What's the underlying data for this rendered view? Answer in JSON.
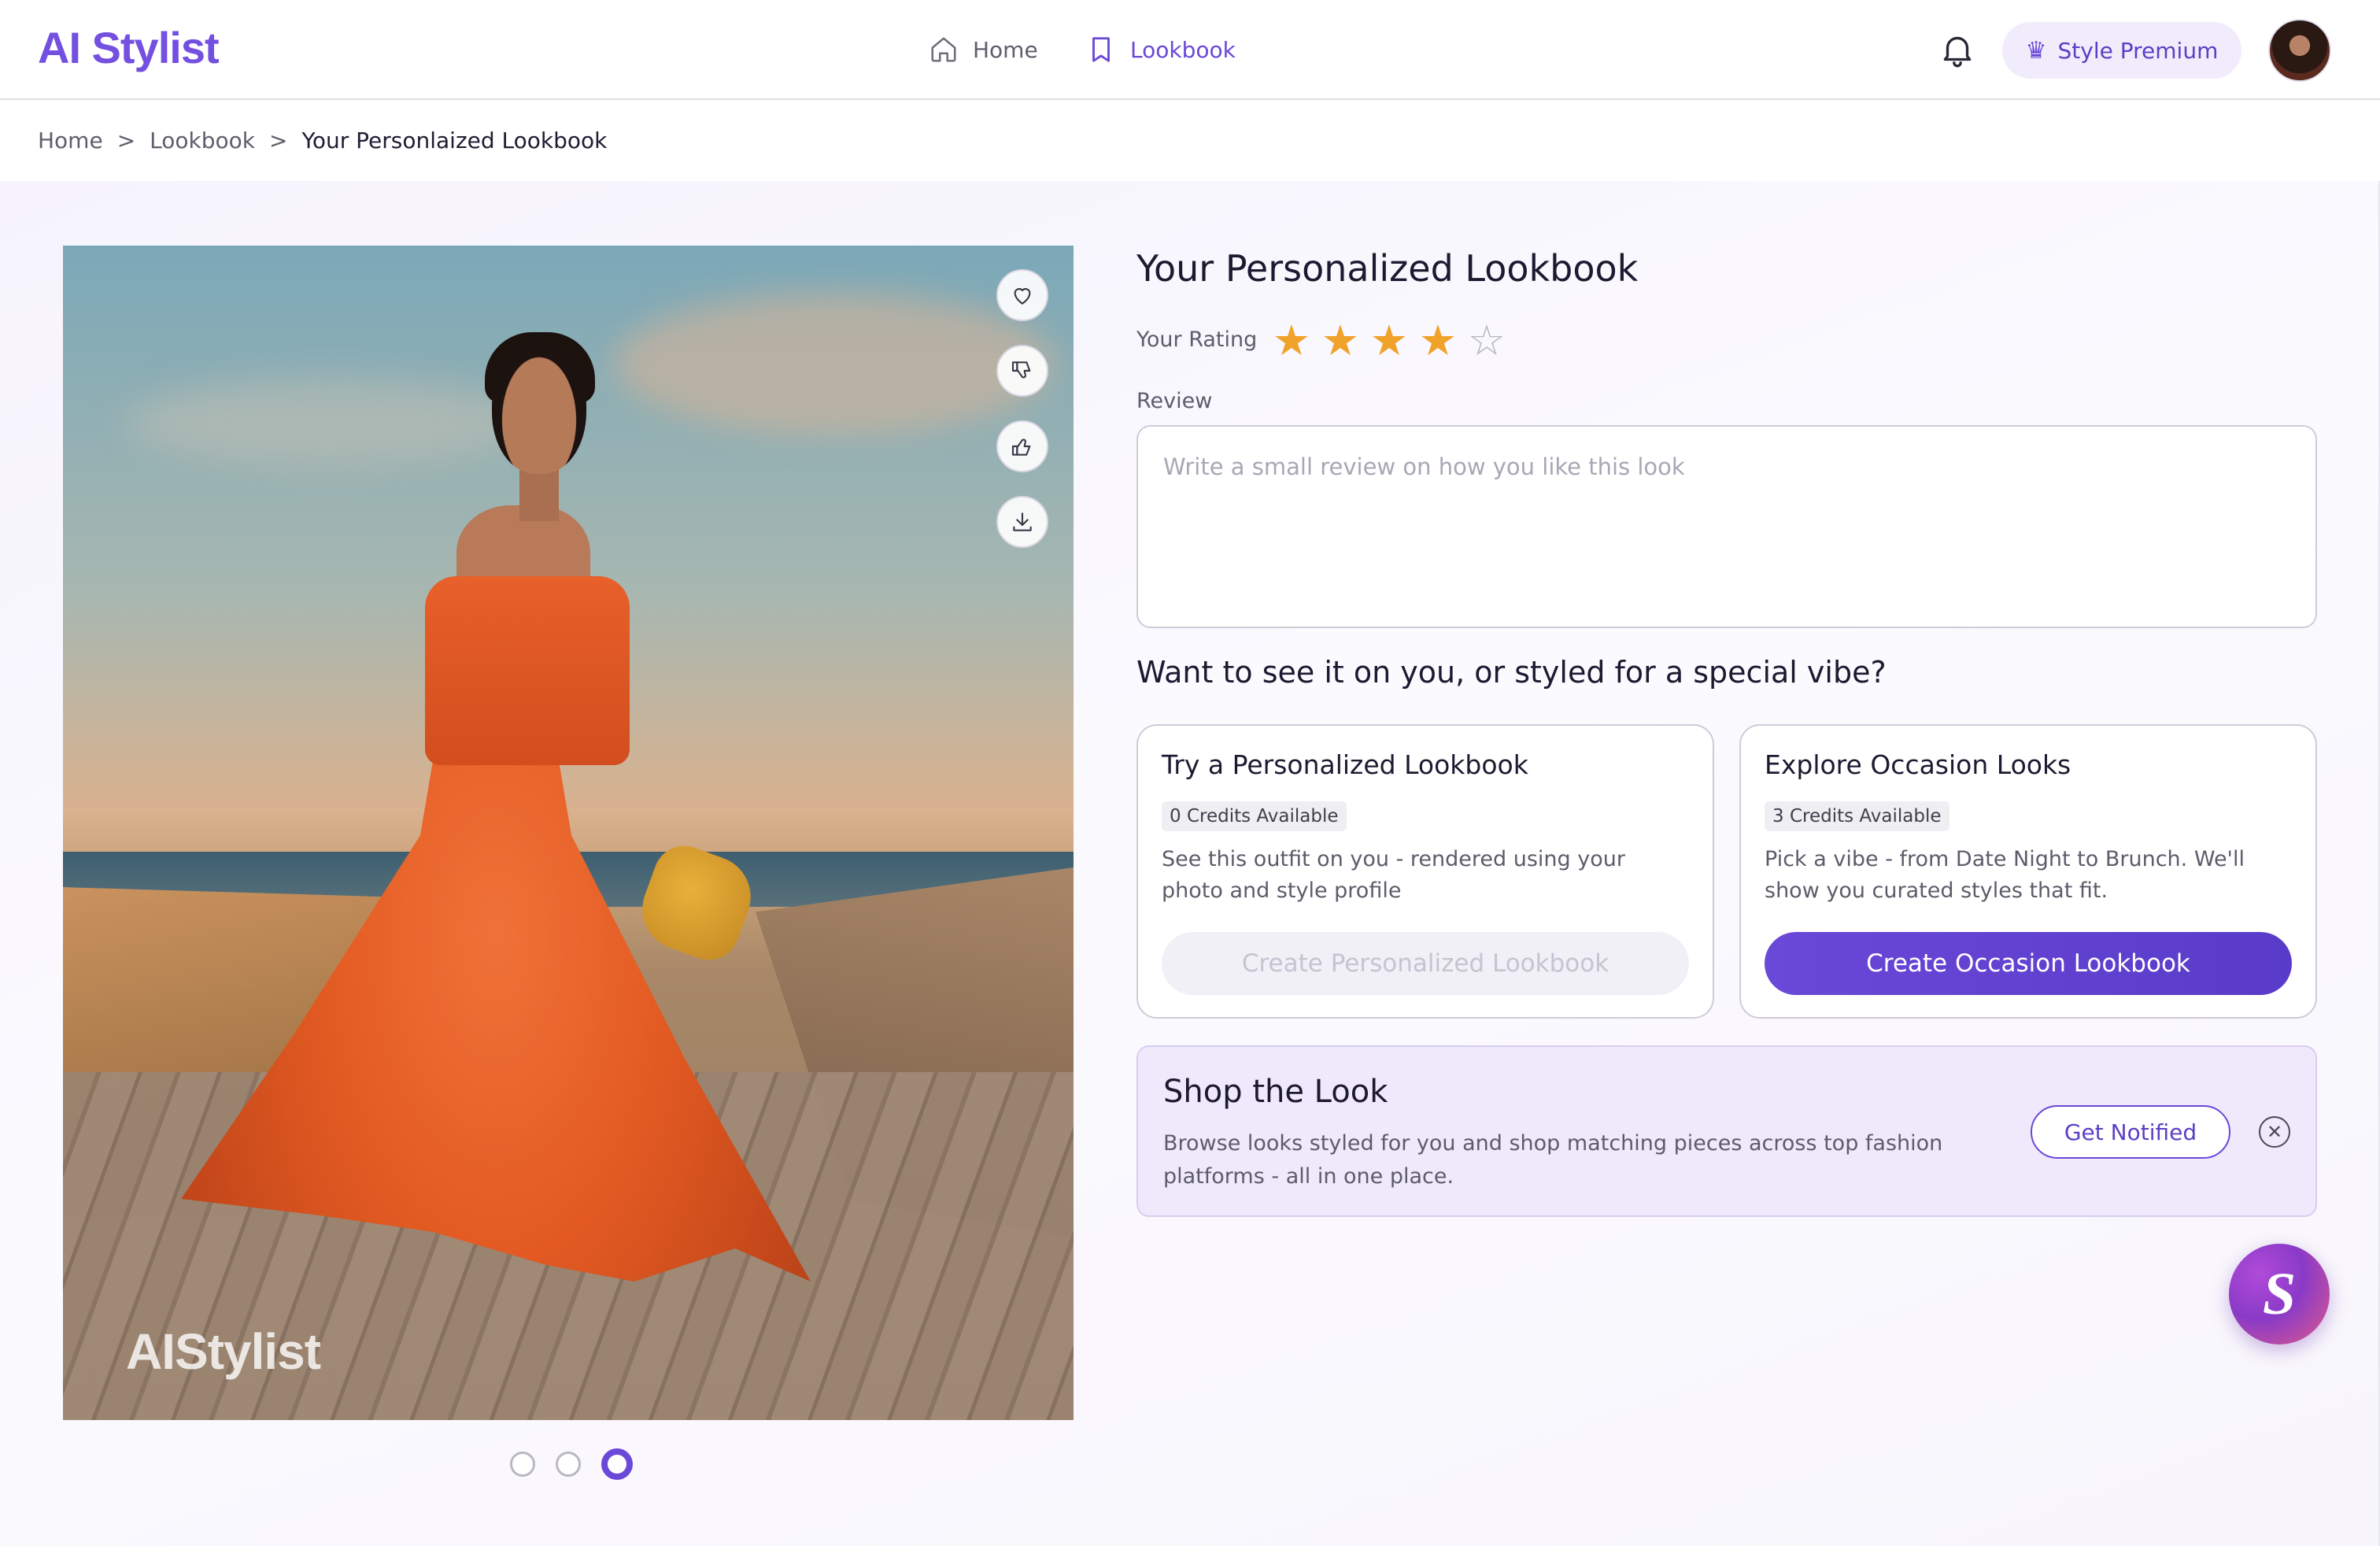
{
  "header": {
    "logo": "AI Stylist",
    "nav": [
      {
        "label": "Home",
        "icon": "home-icon"
      },
      {
        "label": "Lookbook",
        "icon": "bookmark-icon"
      }
    ],
    "premium_label": "Style Premium",
    "premium_icon": "crown-icon"
  },
  "breadcrumb": {
    "items": [
      "Home",
      "Lookbook",
      "Your Personlaized Lookbook"
    ],
    "separator": ">"
  },
  "image": {
    "watermark": "AIStylist",
    "actions": [
      "heart-icon",
      "thumbs-down-icon",
      "thumbs-up-icon",
      "download-icon"
    ],
    "slides_total": 3,
    "slide_active": 3
  },
  "detail": {
    "title": "Your Personalized Lookbook",
    "rating_label": "Your Rating",
    "rating_value": 4,
    "rating_max": 5,
    "review_label": "Review",
    "review_placeholder": "Write a small review on how you like this look",
    "subheading": "Want to see it on you, or styled for a special vibe?"
  },
  "cards": [
    {
      "title": "Try a Personalized Lookbook",
      "credits": "0 Credits Available",
      "desc": "See this outfit on you - rendered using your photo and style profile",
      "button": "Create Personalized Lookbook",
      "enabled": false
    },
    {
      "title": "Explore Occasion Looks",
      "credits": "3 Credits Available",
      "desc": "Pick a vibe - from Date Night to Brunch. We'll show you curated styles that fit.",
      "button": "Create Occasion Lookbook",
      "enabled": true
    }
  ],
  "shop": {
    "title": "Shop the Look",
    "desc": "Browse looks styled for you and shop matching pieces across top fashion platforms - all in one place.",
    "button": "Get Notified"
  },
  "fab_label": "S",
  "colors": {
    "accent": "#6a48d8",
    "star": "#f0a22b",
    "shop_bg": "#efe9fb"
  }
}
